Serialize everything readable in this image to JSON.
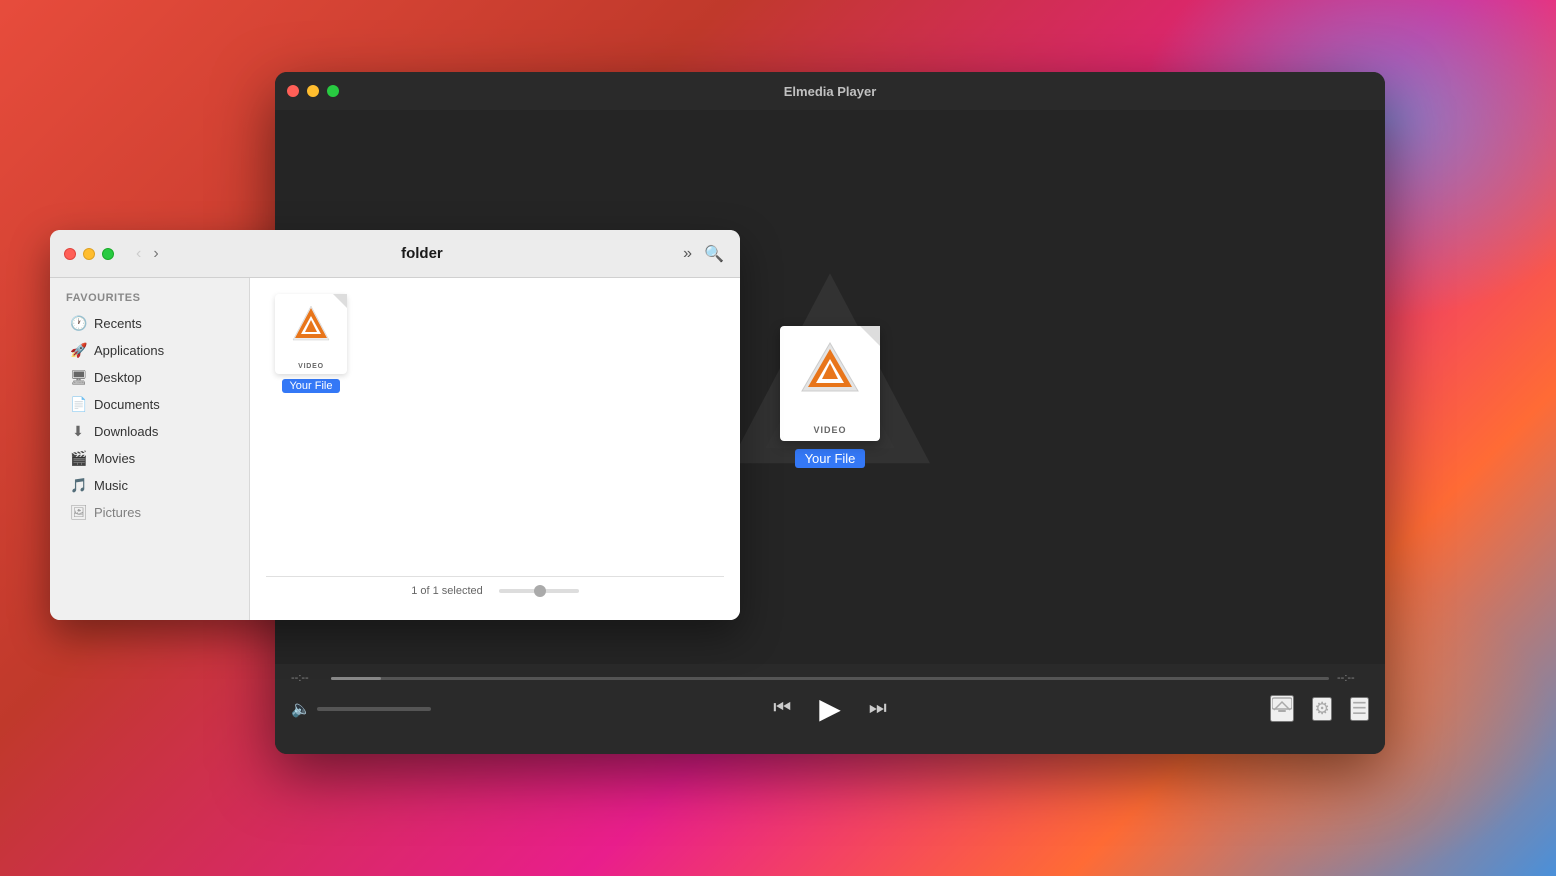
{
  "desktop": {
    "bg_note": "macOS Big Sur style gradient background"
  },
  "player": {
    "title": "Elmedia Player",
    "traffic_lights": {
      "close": "close",
      "minimize": "minimize",
      "maximize": "maximize"
    },
    "file": {
      "label": "VIDEO",
      "name": "Your File"
    },
    "controls": {
      "time_start": "--:--",
      "time_end": "--:--",
      "prev_label": "⏮",
      "play_label": "▶",
      "next_label": "⏭",
      "volume_icon": "🔈",
      "airplay_icon": "airplay",
      "settings_icon": "settings",
      "playlist_icon": "playlist"
    }
  },
  "finder": {
    "title": "folder",
    "traffic_lights": {
      "close": "close",
      "minimize": "minimize",
      "maximize": "maximize"
    },
    "sidebar": {
      "section_title": "Favourites",
      "items": [
        {
          "label": "Recents",
          "icon": "🕐"
        },
        {
          "label": "Applications",
          "icon": "🚀"
        },
        {
          "label": "Desktop",
          "icon": "🖥"
        },
        {
          "label": "Documents",
          "icon": "📄"
        },
        {
          "label": "Downloads",
          "icon": "⬇"
        },
        {
          "label": "Movies",
          "icon": "🎬"
        },
        {
          "label": "Music",
          "icon": "🎵"
        },
        {
          "label": "Pictures",
          "icon": "🖼"
        }
      ]
    },
    "file": {
      "label": "VIDEO",
      "name": "Your File"
    },
    "status": {
      "text": "1 of 1 selected"
    }
  }
}
